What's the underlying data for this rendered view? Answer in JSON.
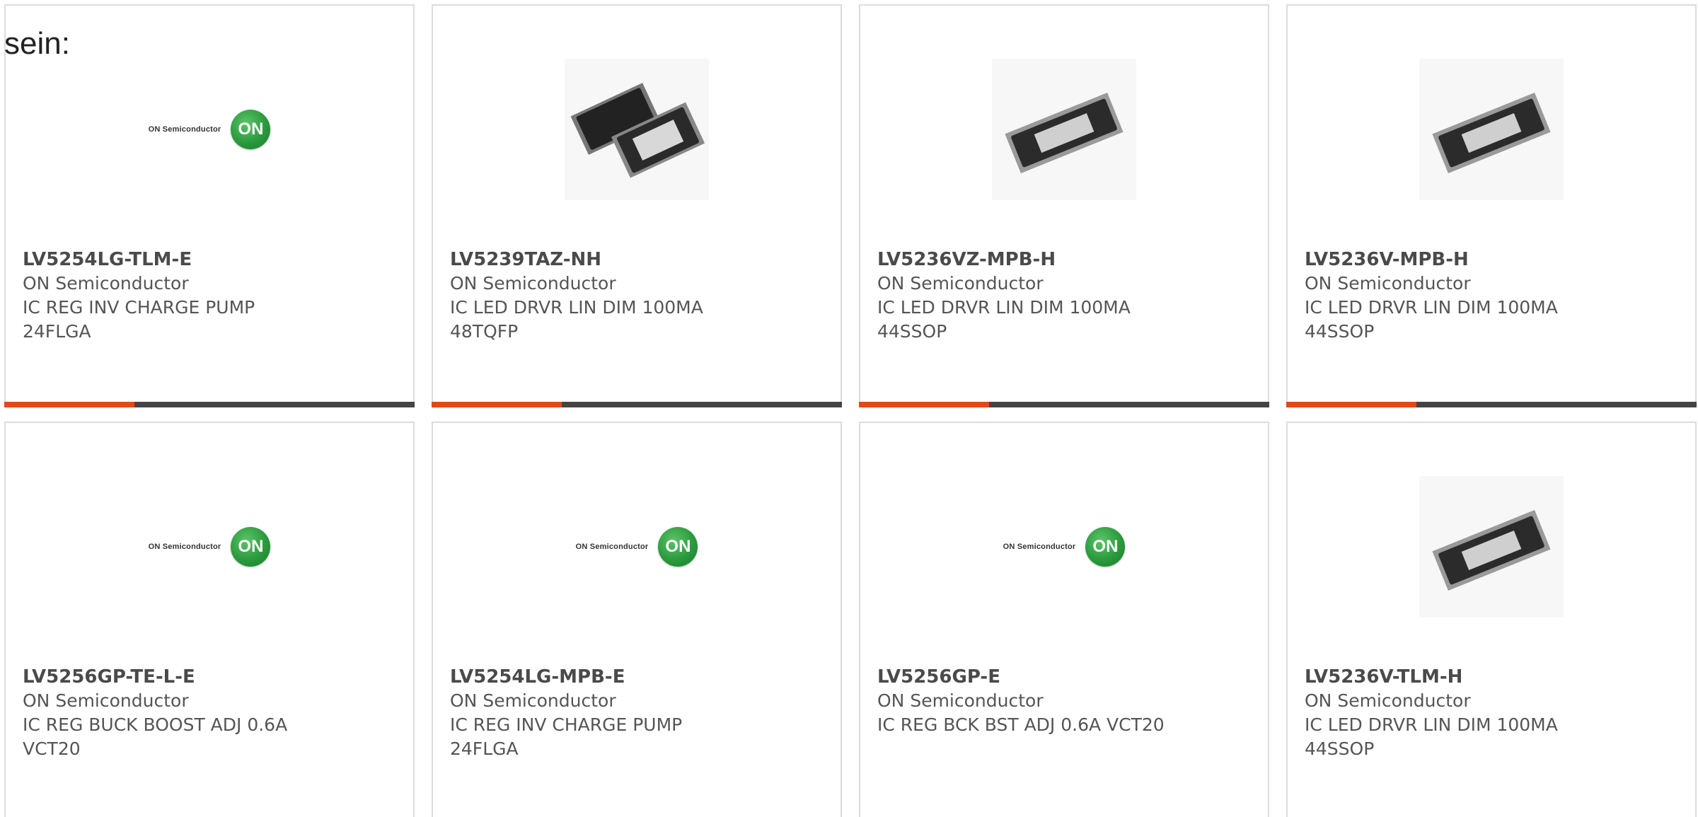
{
  "intro_text": "sein:",
  "brand_name": "ON Semiconductor",
  "logo_text": "ON",
  "colors": {
    "accent": "#e1491a",
    "bar": "#444444",
    "border": "#dcdcdc"
  },
  "products": [
    {
      "part": "LV5254LG-TLM-E",
      "maker": "ON Semiconductor",
      "desc1": "IC REG INV CHARGE PUMP",
      "desc2": "24FLGA",
      "image": "on-semiconductor-logo"
    },
    {
      "part": "LV5239TAZ-NH",
      "maker": "ON Semiconductor",
      "desc1": "IC LED DRVR LIN DIM 100MA",
      "desc2": "48TQFP",
      "image": "tqfp-chip-photo"
    },
    {
      "part": "LV5236VZ-MPB-H",
      "maker": "ON Semiconductor",
      "desc1": "IC LED DRVR LIN DIM 100MA",
      "desc2": "44SSOP",
      "image": "ssop-chip-photo"
    },
    {
      "part": "LV5236V-MPB-H",
      "maker": "ON Semiconductor",
      "desc1": "IC LED DRVR LIN DIM 100MA",
      "desc2": "44SSOP",
      "image": "ssop-chip-photo"
    },
    {
      "part": "LV5256GP-TE-L-E",
      "maker": "ON Semiconductor",
      "desc1": "IC REG BUCK BOOST ADJ 0.6A",
      "desc2": "VCT20",
      "image": "on-semiconductor-logo"
    },
    {
      "part": "LV5254LG-MPB-E",
      "maker": "ON Semiconductor",
      "desc1": "IC REG INV CHARGE PUMP",
      "desc2": "24FLGA",
      "image": "on-semiconductor-logo"
    },
    {
      "part": "LV5256GP-E",
      "maker": "ON Semiconductor",
      "desc1": "IC REG BCK BST ADJ 0.6A VCT20",
      "desc2": "",
      "image": "on-semiconductor-logo"
    },
    {
      "part": "LV5236V-TLM-H",
      "maker": "ON Semiconductor",
      "desc1": "IC LED DRVR LIN DIM 100MA",
      "desc2": "44SSOP",
      "image": "ssop-chip-photo"
    }
  ]
}
